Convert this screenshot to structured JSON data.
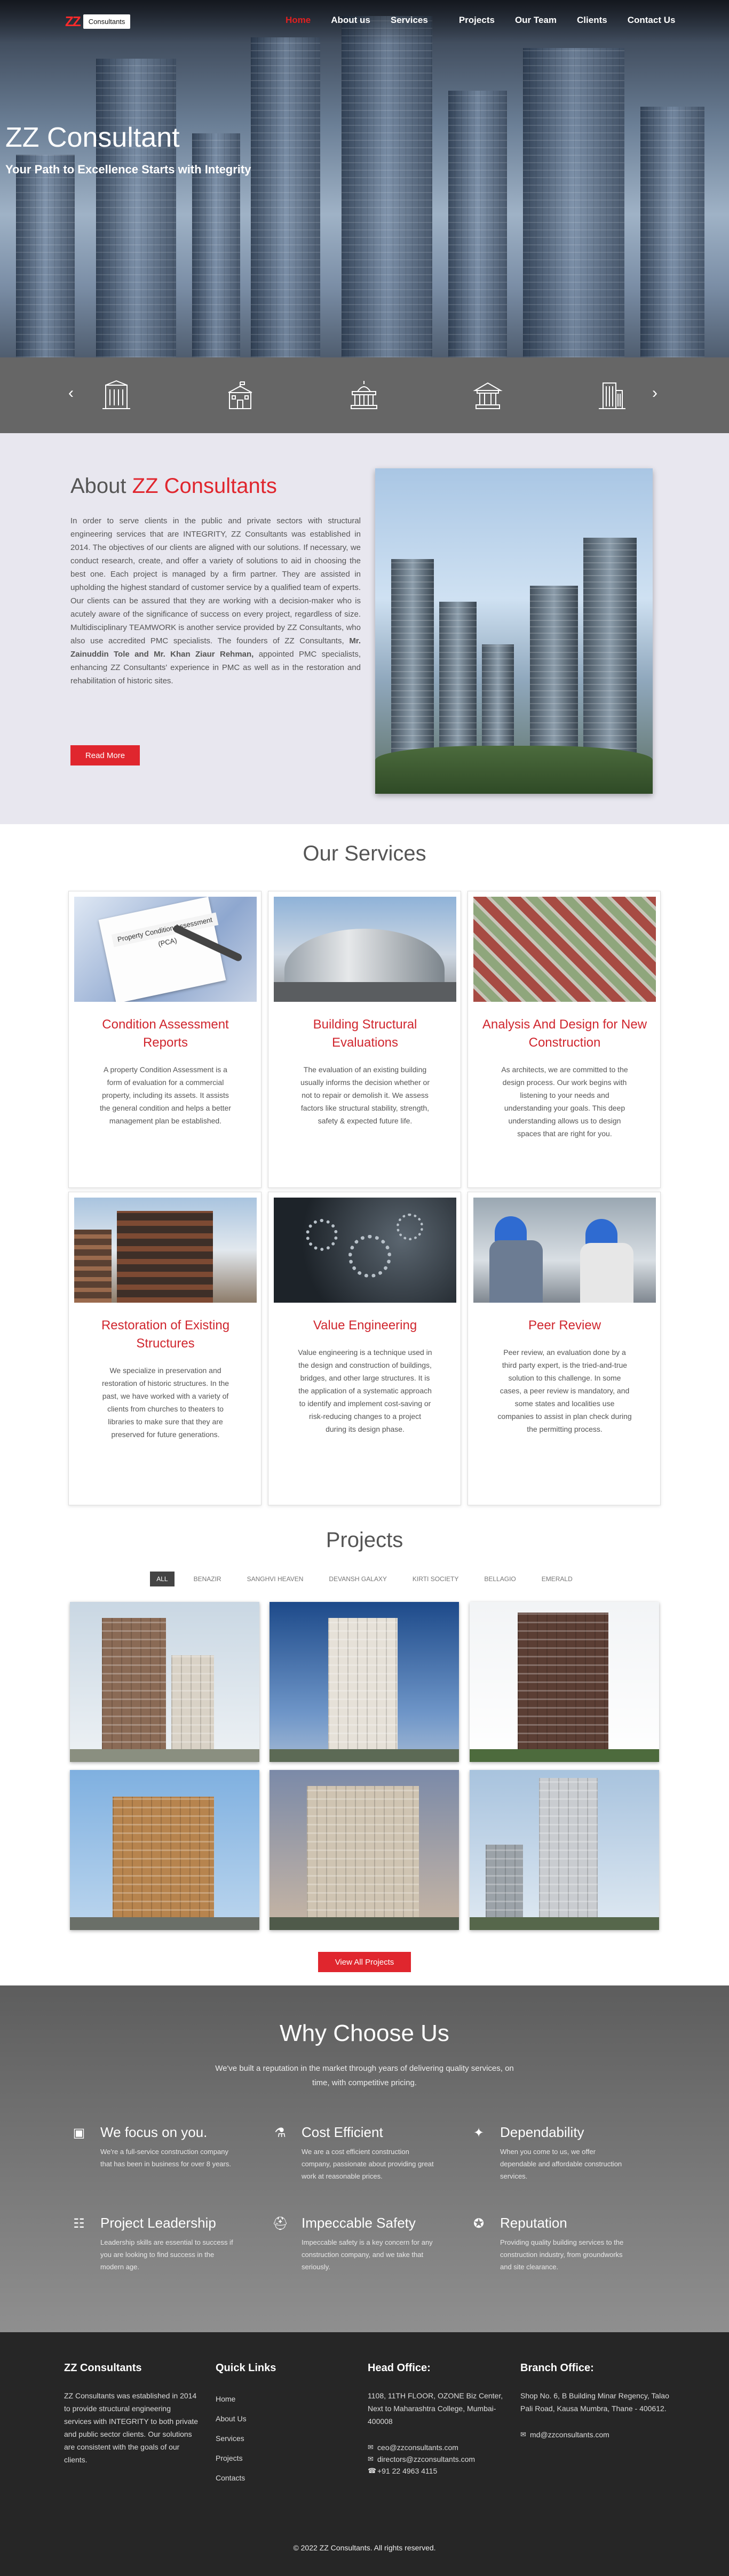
{
  "brand": {
    "logo_mark": "ZZ",
    "logo_text": "Consultants"
  },
  "nav": [
    "Home",
    "About us",
    "Services",
    "Projects",
    "Our Team",
    "Clients",
    "Contact Us"
  ],
  "hero": {
    "title": "ZZ Consultant",
    "subtitle": "Your Path to Excellence Starts with Integrity"
  },
  "strip": {
    "prev": "‹",
    "next": "›"
  },
  "about": {
    "heading_prefix": "About",
    "heading_accent": "ZZ Consultants",
    "para1": "In order to serve clients in the public and private sectors with structural engineering services that are INTEGRITY, ZZ Consultants was established in 2014. The objectives of our clients are aligned with our solutions. If necessary, we conduct research, create, and offer a variety of solutions to aid in choosing the best one. Each project is managed by a firm partner. They are assisted in upholding the highest standard of customer service by a qualified team of experts. Our clients can be assured that they are working with a decision-maker who is acutely aware of the significance of success on every project, regardless of size. Multidisciplinary TEAMWORK is another service provided by ZZ Consultants, who also use accredited PMC specialists. The founders of ZZ Consultants,",
    "founders": "Mr. Zainuddin Tole and Mr. Khan Ziaur Rehman,",
    "para2": " appointed PMC specialists, enhancing ZZ Consultants' experience in PMC as well as in the restoration and rehabilitation of historic sites.",
    "button": "Read More"
  },
  "services": {
    "title": "Our Services",
    "items": [
      {
        "title": "Condition Assessment Reports",
        "text": "A property Condition Assessment is a form of evaluation for a commercial property, including its assets. It assists the general condition and helps a better management plan be established."
      },
      {
        "title": "Building Structural Evaluations",
        "text": "The evaluation of an existing building usually informs the decision whether or not to repair or demolish it. We assess factors like structural stability, strength, safety & expected future life."
      },
      {
        "title": "Analysis And Design for New Construction",
        "text": "As architects, we are committed to the design process. Our work begins with listening to your needs and understanding your goals. This deep understanding allows us to design spaces that are right for you."
      },
      {
        "title": "Restoration of Existing Structures",
        "text": "We specialize in preservation and restoration of historic structures. In the past, we have worked with a variety of clients from churches to theaters to libraries to make sure that they are preserved for future generations."
      },
      {
        "title": "Value Engineering",
        "text": "Value engineering is a technique used in the design and construction of buildings, bridges, and other large structures. It is the application of a systematic approach to identify and implement cost-saving or risk-reducing changes to a project during its design phase."
      },
      {
        "title": "Peer Review",
        "text": "Peer review, an evaluation done by a third party expert, is the tried-and-true solution to this challenge. In some cases, a peer review is mandatory, and some states and localities use companies to assist in plan check during the permitting process."
      }
    ]
  },
  "projects": {
    "title": "Projects",
    "filters": [
      "ALL",
      "BENAZIR",
      "SANGHVI HEAVEN",
      "DEVANSH GALAXY",
      "KIRTI SOCIETY",
      "BELLAGIO",
      "EMERALD"
    ],
    "view_all": "View All Projects"
  },
  "why": {
    "title": "Why Choose Us",
    "intro": "We've built a reputation in the market through years of delivering quality services, on time, with competitive pricing.",
    "features": [
      {
        "icon": "building-icon",
        "title": "We focus on you.",
        "text": "We're a full-service construction company that has been in business for over 8 years."
      },
      {
        "icon": "flask-icon",
        "title": "Cost Efficient",
        "text": "We are a cost efficient construction company, passionate about providing great work at reasonable prices."
      },
      {
        "icon": "handshake-icon",
        "title": "Dependability",
        "text": "When you come to us, we offer dependable and affordable construction services."
      },
      {
        "icon": "team-icon",
        "title": "Project Leadership",
        "text": "Leadership skills are essential to success if you are looking to find success in the modern age."
      },
      {
        "icon": "hardhat-icon",
        "title": "Impeccable Safety",
        "text": "Impeccable safety is a key concern for any construction company, and we take that seriously."
      },
      {
        "icon": "award-icon",
        "title": "Reputation",
        "text": "Providing quality building services to the construction industry, from groundworks and site clearance."
      }
    ]
  },
  "footer": {
    "about_title": "ZZ Consultants",
    "about_text": "ZZ Consultants was established in 2014 to provide structural engineering services with INTEGRITY to both private and public sector clients. Our solutions are consistent with the goals of our clients.",
    "links_title": "Quick Links",
    "links": [
      "Home",
      "About Us",
      "Services",
      "Projects",
      "Contacts"
    ],
    "head_title": "Head Office:",
    "head_address": "1108, 11TH FLOOR, OZONE Biz Center, Next to Maharashtra College, Mumbai-400008",
    "head_email1": "ceo@zzconsultants.com",
    "head_email2": "directors@zzconsultants.com",
    "head_phone": "+91 22 4963 4115",
    "branch_title": "Branch Office:",
    "branch_address": "Shop No. 6, B Building Minar Regency, Talao Pali Road, Kausa Mumbra, Thane - 400612.",
    "branch_email": "md@zzconsultants.com",
    "copyright": "© 2022 ZZ Consultants. All rights reserved."
  }
}
